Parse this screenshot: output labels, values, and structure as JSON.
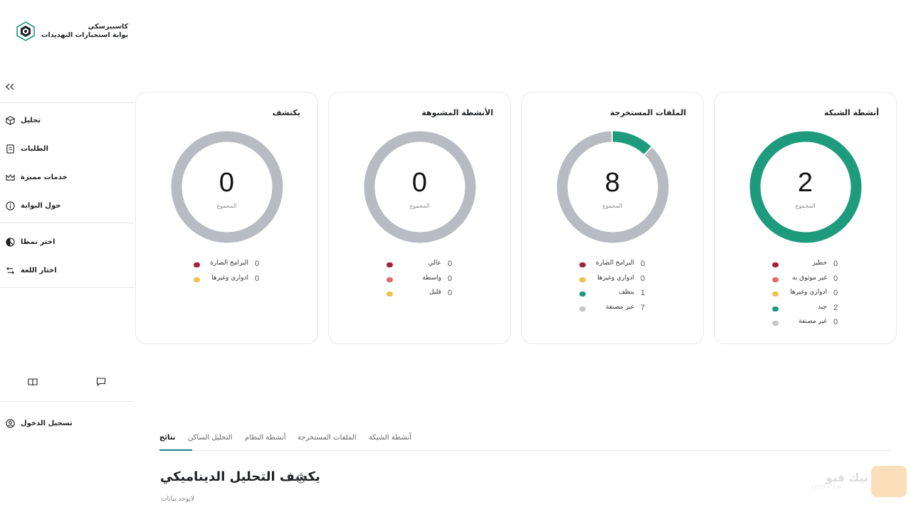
{
  "app": {
    "brand_line1": "كاسبيرسكي",
    "brand_line2": "بوابة استخبارات التهديدات"
  },
  "sidebar": {
    "collapse_icon": "double-chevron-left-icon",
    "items": [
      {
        "label": "تحليل",
        "icon": "cube-icon"
      },
      {
        "label": "الطلبات",
        "icon": "document-icon"
      },
      {
        "label": "خدمات مميزة",
        "icon": "crown-icon"
      },
      {
        "label": "حول البوابة",
        "icon": "info-icon"
      },
      {
        "label": "اختر نمطا",
        "icon": "theme-icon"
      },
      {
        "label": "اختار اللغة",
        "icon": "language-icon"
      }
    ],
    "footer_icons": [
      "book-icon",
      "chat-icon"
    ],
    "login": {
      "label": "تسجيل الدخول",
      "icon": "user-circle-icon"
    }
  },
  "colors": {
    "gray": "#b8bcc2",
    "teal": "#1e9b7d",
    "red": "#a3213a",
    "pink": "#e06b6b",
    "yellow": "#f0c04a",
    "light_gray": "#c4c6c8",
    "accent": "#1a7f86"
  },
  "cards": [
    {
      "title": "يكتشف",
      "total": "0",
      "total_label": "المجموع",
      "legend": [
        {
          "label": "البرامج الضارة",
          "value": "0",
          "color": "#a3213a"
        },
        {
          "label": "ادواري وغيرها",
          "value": "0",
          "color": "#f0c04a"
        }
      ]
    },
    {
      "title": "الأنشطة المشبوهة",
      "total": "0",
      "total_label": "المجموع",
      "legend": [
        {
          "label": "عالي",
          "value": "0",
          "color": "#a3213a"
        },
        {
          "label": "واسطة",
          "value": "0",
          "color": "#e06b6b"
        },
        {
          "label": "قليل",
          "value": "0",
          "color": "#f0c04a"
        }
      ]
    },
    {
      "title": "الملفات المستخرجة",
      "total": "8",
      "total_label": "المجموع",
      "legend": [
        {
          "label": "البرامج الضارة",
          "value": "0",
          "color": "#a3213a"
        },
        {
          "label": "ادواري وغيرها",
          "value": "0",
          "color": "#f0c04a"
        },
        {
          "label": "ينظف",
          "value": "1",
          "color": "#1e9b7d"
        },
        {
          "label": "غير مصنفة",
          "value": "7",
          "color": "#c4c6c8"
        }
      ]
    },
    {
      "title": "أنشطة الشبكة",
      "total": "2",
      "total_label": "المجموع",
      "legend": [
        {
          "label": "خطير",
          "value": "0",
          "color": "#a3213a"
        },
        {
          "label": "غير موثوق به",
          "value": "0",
          "color": "#e06b6b"
        },
        {
          "label": "ادواري وغيرها",
          "value": "0",
          "color": "#f0c04a"
        },
        {
          "label": "جيد",
          "value": "2",
          "color": "#1e9b7d"
        },
        {
          "label": "غير مصنفة",
          "value": "0",
          "color": "#c4c6c8"
        }
      ]
    }
  ],
  "tabs": [
    {
      "label": "نتائج",
      "active": true
    },
    {
      "label": "التحليل الساكن",
      "active": false
    },
    {
      "label": "أنشطة النظام",
      "active": false
    },
    {
      "label": "الملفات المستخرجة",
      "active": false
    },
    {
      "label": "أنشطة الشبكة",
      "active": false
    }
  ],
  "section": {
    "title": "يكشف التحليل الديناميكي",
    "empty": "لاتوجد بيانات"
  },
  "watermark": {
    "text": "تيك فيو",
    "sub": "TECH VIEW"
  }
}
